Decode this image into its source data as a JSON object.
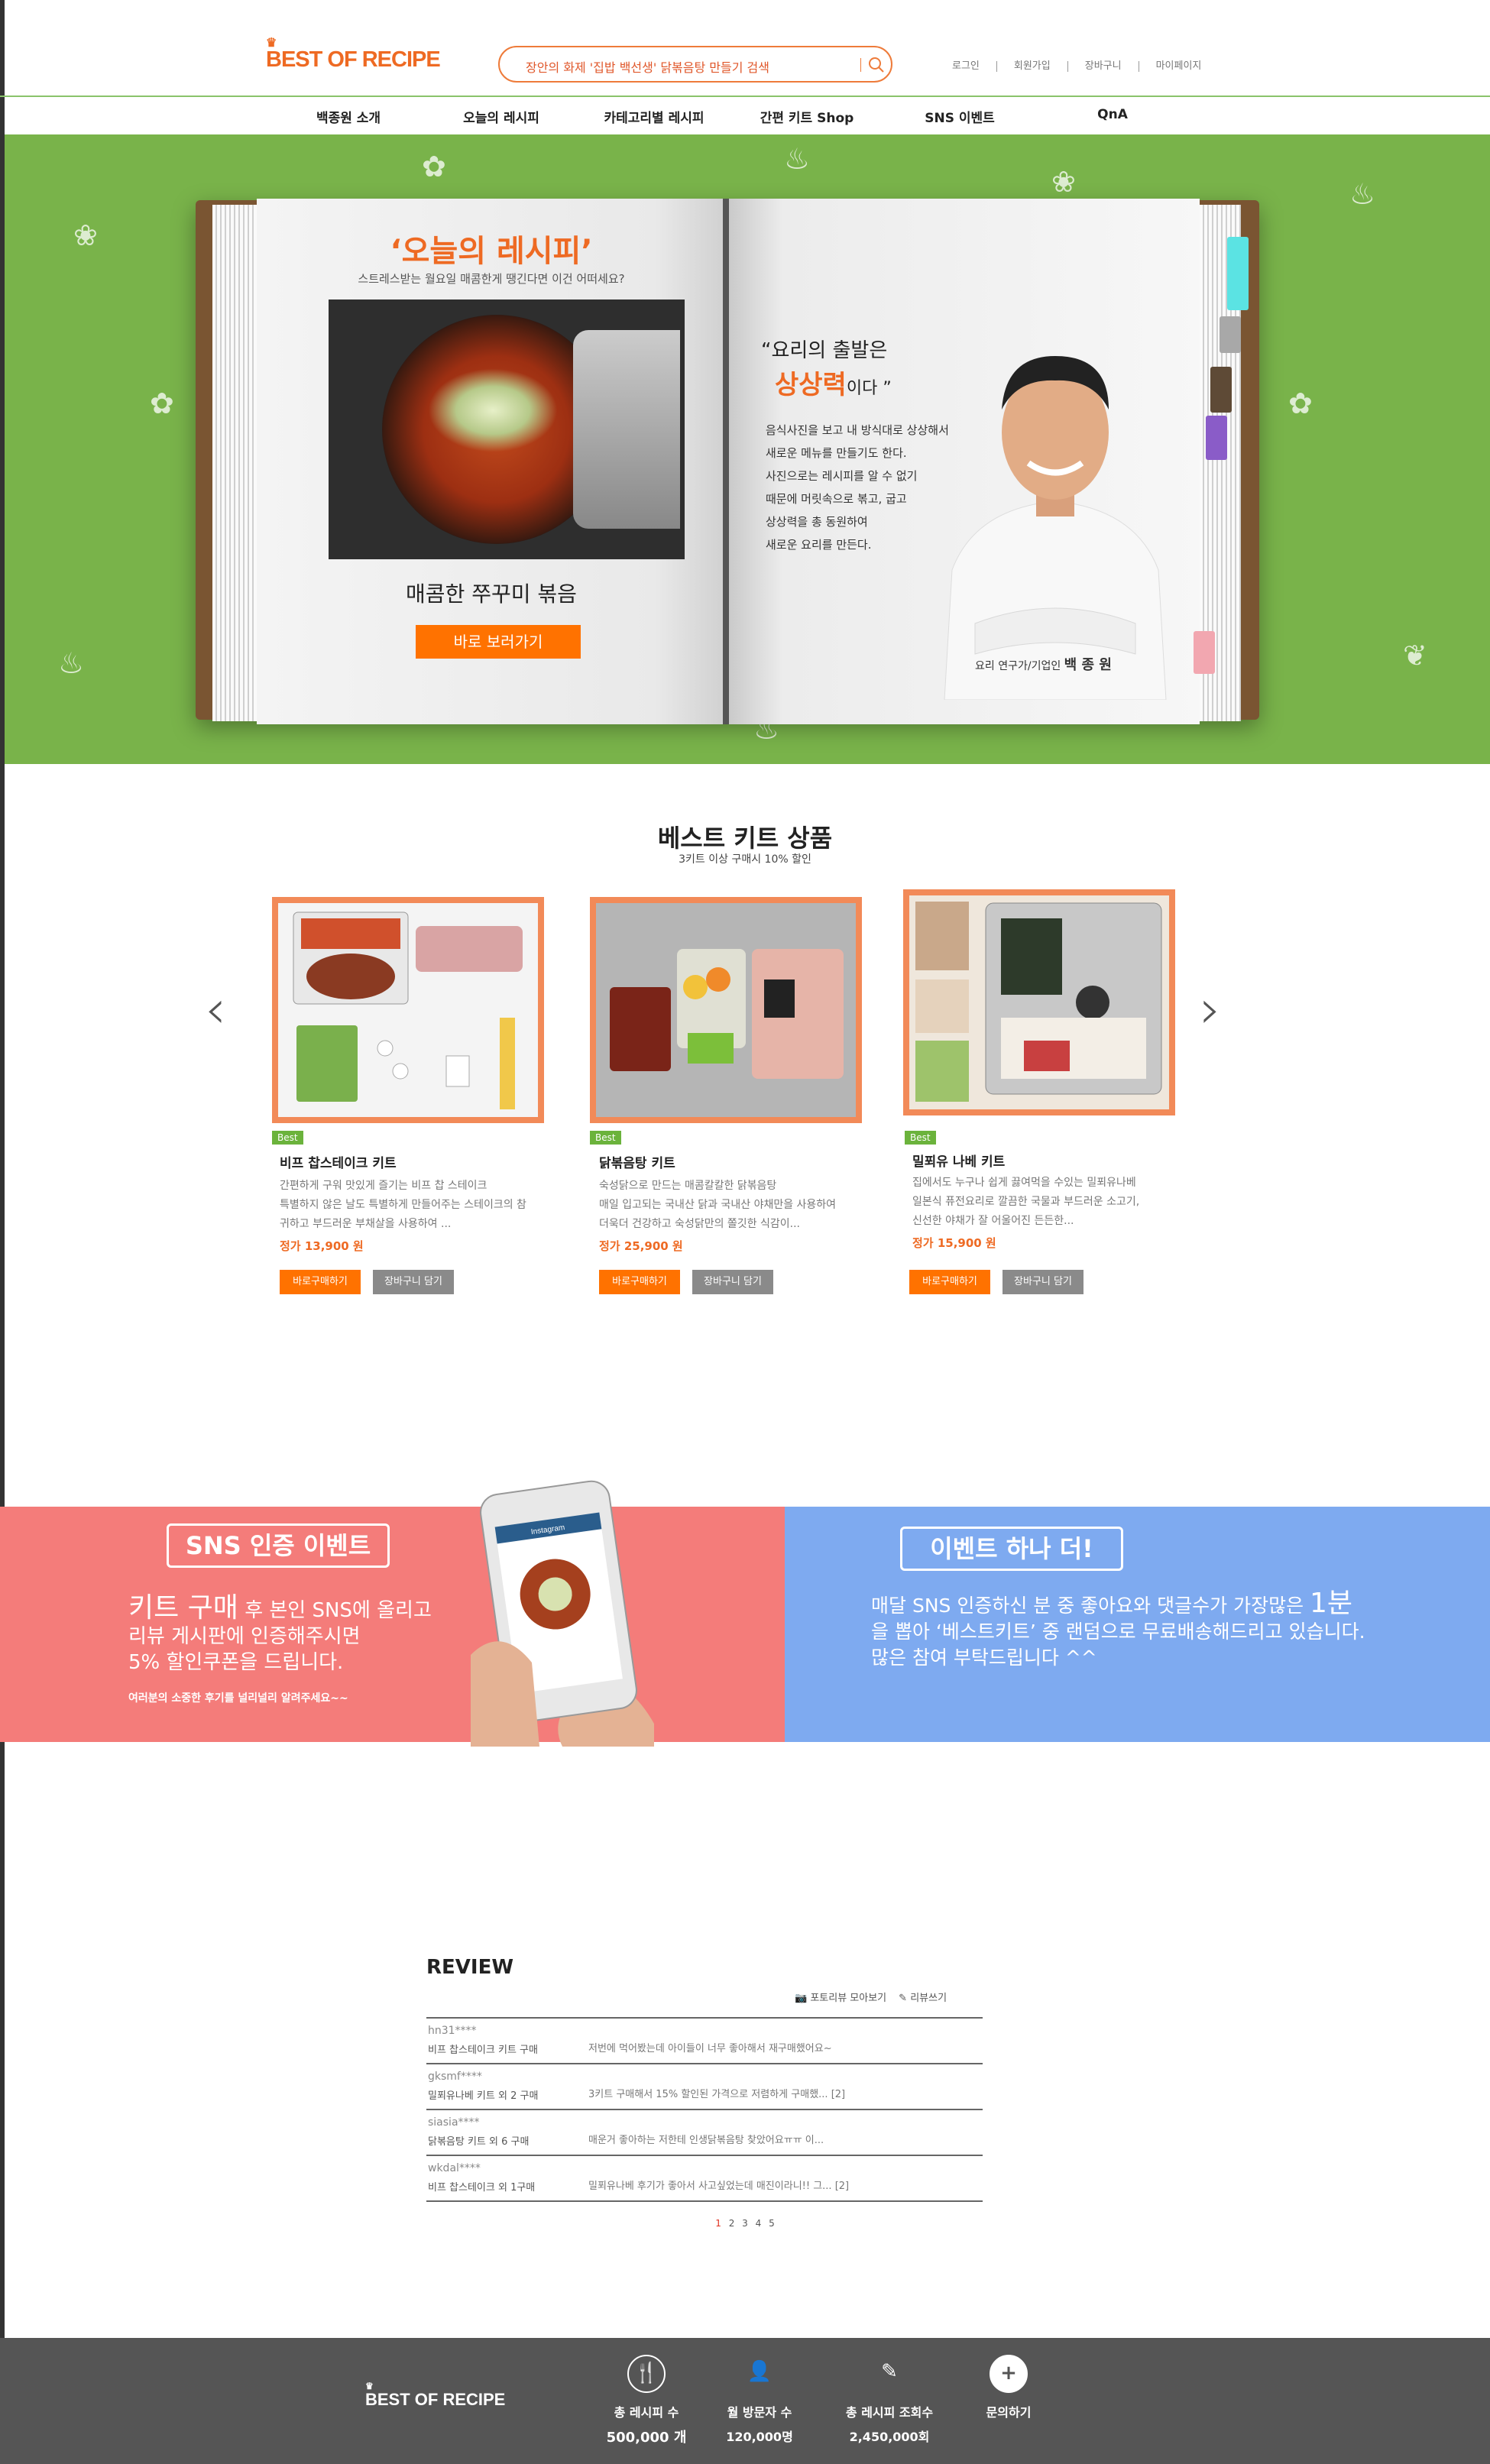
{
  "header": {
    "logo": "BEST OF RECIPE",
    "search_placeholder": "장안의 화제 '집밥 백선생' 닭볶음탕 만들기 검색",
    "links": [
      "로그인",
      "회원가입",
      "장바구니",
      "마이페이지"
    ]
  },
  "nav": [
    "백종원 소개",
    "오늘의 레시피",
    "카테고리별 레시피",
    "간편 키트 Shop",
    "SNS 이벤트",
    "QnA"
  ],
  "hero": {
    "title": "‘오늘의 레시피’",
    "subtitle": "스트레스받는 월요일 매콤한게 땡긴다면 이건 어떠세요?",
    "dish_name": "매콤한 쭈꾸미 볶음",
    "cta": "바로 보러가기",
    "quote_open": "“요리의 출발은",
    "quote_highlight": "상상력",
    "quote_close": "이다 ”",
    "quote_lines": [
      "음식사진을 보고 내 방식대로 상상해서",
      "새로운 메뉴를 만들기도 한다.",
      "사진으로는 레시피를 알 수 없기",
      "때문에 머릿속으로 볶고, 굽고",
      "상상력을 총 동원하여",
      "새로운 요리를 만든다."
    ],
    "chef_role": "요리 연구가/기업인",
    "chef_name": "백 종 원"
  },
  "best_kits": {
    "title": "베스트 키트 상품",
    "subtitle": "3키트 이상 구매시 10% 할인",
    "items": [
      {
        "badge": "Best",
        "name": "비프 찹스테이크 키트",
        "desc": [
          "간편하게 구워 맛있게 즐기는 비프 찹 스테이크",
          "특별하지 않은 날도 특별하게 만들어주는 스테이크의 참",
          "귀하고 부드러운 부채살을 사용하여 ..."
        ],
        "price": "정가 13,900 원",
        "buy": "바로구매하기",
        "cart": "장바구니 담기"
      },
      {
        "badge": "Best",
        "name": "닭볶음탕 키트",
        "desc": [
          "숙성닭으로 만드는 매콤칼칼한 닭볶음탕",
          "매일 입고되는 국내산 닭과 국내산 야채만을 사용하여",
          "더욱더 건강하고 숙성닭만의 쫄깃한 식감이..."
        ],
        "price": "정가 25,900 원",
        "buy": "바로구매하기",
        "cart": "장바구니 담기"
      },
      {
        "badge": "Best",
        "name": "밀푀유 나베 키트",
        "desc": [
          "집에서도 누구나 쉽게 끓여먹을 수있는 밀푀유나베",
          "일본식 퓨전요리로 깔끔한 국물과 부드러운 소고기,",
          "신선한 야채가 잘 어울어진 든든한..."
        ],
        "price": "정가 15,900 원",
        "buy": "바로구매하기",
        "cart": "장바구니 담기"
      }
    ]
  },
  "sns": {
    "left_title": "SNS 인증 이벤트",
    "left_big": "키트 구매",
    "left_line1_rest": " 후 본인 SNS에 올리고",
    "left_line2": "리뷰 게시판에 인증해주시면",
    "left_line3": "5% 할인쿠폰을 드립니다.",
    "left_small": "여러분의 소중한 후기를 널리널리 알려주세요~~",
    "phone_app": "Instagram",
    "right_title": "이벤트 하나 더!",
    "right_line1": "매달 SNS 인증하신 분 중  좋아요와 댓글수가 가장많은 ",
    "right_big": "1분",
    "right_line2": "을 뽑아  ‘베스트키트’ 중 랜덤으로 무료배송해드리고 있습니다.",
    "right_line3": "많은 참여 부탁드립니다 ^^"
  },
  "review": {
    "title": "REVIEW",
    "photo_link": "포토리뷰 모아보기",
    "write_link": "리뷰쓰기",
    "rows": [
      {
        "user": "hn31****",
        "product": "비프 찹스테이크 키트 구매",
        "text": "저번에 먹어봤는데 아이들이 너무 좋아해서 재구매했어요~"
      },
      {
        "user": "gksmf****",
        "product": "밀푀유나베 키트 외 2 구매",
        "text": "3키트 구매해서 15% 할인된 가격으로 저렴하게 구매했... [2]"
      },
      {
        "user": "siasia****",
        "product": "닭볶음탕 키트 외 6 구매",
        "text": "매운거 좋아하는 저한테 인생닭볶음탕 찾았어요ㅠㅠ 이..."
      },
      {
        "user": "wkdal****",
        "product": "비프 찹스테이크 외 1구매",
        "text": "밀푀유나베 후기가 좋아서 사고싶었는데 매진이라니!! 그... [2]"
      }
    ],
    "pages": [
      "1",
      "2",
      "3",
      "4",
      "5"
    ],
    "active_page": "1"
  },
  "footer": {
    "logo": "BEST OF RECIPE",
    "stats": [
      {
        "icon": "utensils-icon",
        "label": "총 레시피 수",
        "value": "500,000 개"
      },
      {
        "icon": "user-icon",
        "label": "월 방문자 수",
        "value": "120,000명"
      },
      {
        "icon": "edit-icon",
        "label": "총 레시피 조회수",
        "value": "2,450,000회"
      },
      {
        "icon": "plus-icon",
        "label": "문의하기",
        "value": ""
      }
    ]
  },
  "colors": {
    "brand_orange": "#ee6a23",
    "hero_green": "#79b34a",
    "sns_red": "#f47c7a",
    "sns_blue": "#7eaaf0",
    "footer_gray": "#555555"
  }
}
